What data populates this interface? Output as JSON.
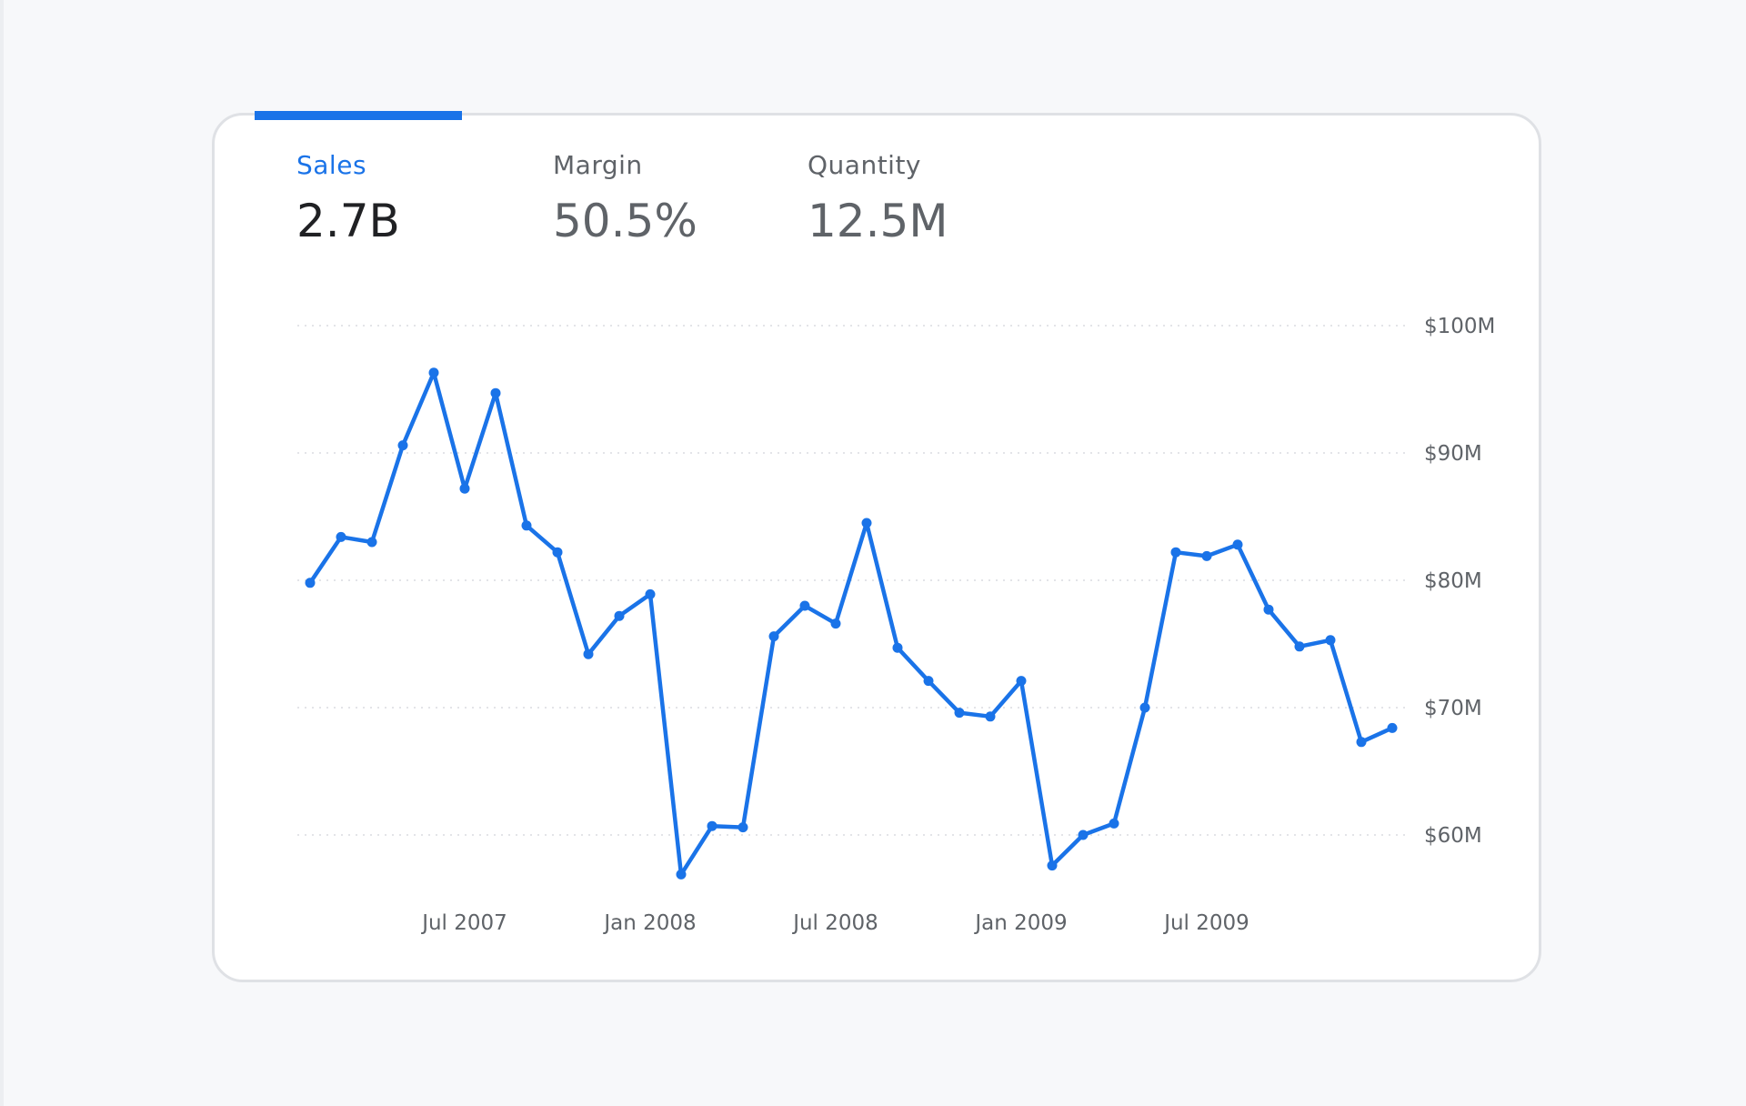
{
  "tabs": [
    {
      "label": "Sales",
      "value": "2.7B",
      "active": true
    },
    {
      "label": "Margin",
      "value": "50.5%",
      "active": false
    },
    {
      "label": "Quantity",
      "value": "12.5M",
      "active": false
    }
  ],
  "colors": {
    "accent": "#1a73e8",
    "line": "#1a73e8",
    "card_border": "#dfe1e5",
    "background": "#f7f8fa"
  },
  "chart_data": {
    "type": "line",
    "title": "",
    "xlabel": "",
    "ylabel": "",
    "ylim": [
      55,
      100
    ],
    "y_ticks": [
      {
        "value": 100,
        "label": "$100M"
      },
      {
        "value": 90,
        "label": "$90M"
      },
      {
        "value": 80,
        "label": "$80M"
      },
      {
        "value": 70,
        "label": "$70M"
      },
      {
        "value": 60,
        "label": "$60M"
      }
    ],
    "x_ticks": [
      {
        "date": "2007-07",
        "label": "Jul 2007"
      },
      {
        "date": "2008-01",
        "label": "Jan 2008"
      },
      {
        "date": "2008-07",
        "label": "Jul 2008"
      },
      {
        "date": "2009-01",
        "label": "Jan 2009"
      },
      {
        "date": "2009-07",
        "label": "Jul 2009"
      }
    ],
    "grid": true,
    "y_axis_side": "right",
    "series": [
      {
        "name": "Sales",
        "x": [
          "2007-02",
          "2007-03",
          "2007-04",
          "2007-05",
          "2007-06",
          "2007-07",
          "2007-08",
          "2007-09",
          "2007-10",
          "2007-11",
          "2007-12",
          "2008-01",
          "2008-02",
          "2008-03",
          "2008-04",
          "2008-05",
          "2008-06",
          "2008-07",
          "2008-08",
          "2008-09",
          "2008-10",
          "2008-11",
          "2008-12",
          "2009-01",
          "2009-02",
          "2009-03",
          "2009-04",
          "2009-05",
          "2009-06",
          "2009-07",
          "2009-08",
          "2009-09",
          "2009-10",
          "2009-11",
          "2009-12",
          "2010-01"
        ],
        "values": [
          79.8,
          83.4,
          83.0,
          90.6,
          96.3,
          87.2,
          94.7,
          84.3,
          82.2,
          74.2,
          77.2,
          78.9,
          56.9,
          60.7,
          60.6,
          75.6,
          78.0,
          76.6,
          84.5,
          74.7,
          72.1,
          69.6,
          69.3,
          72.1,
          57.6,
          60.0,
          60.9,
          70.0,
          82.2,
          81.9,
          82.8,
          77.7,
          74.8,
          75.3,
          67.3,
          68.4
        ]
      }
    ]
  }
}
